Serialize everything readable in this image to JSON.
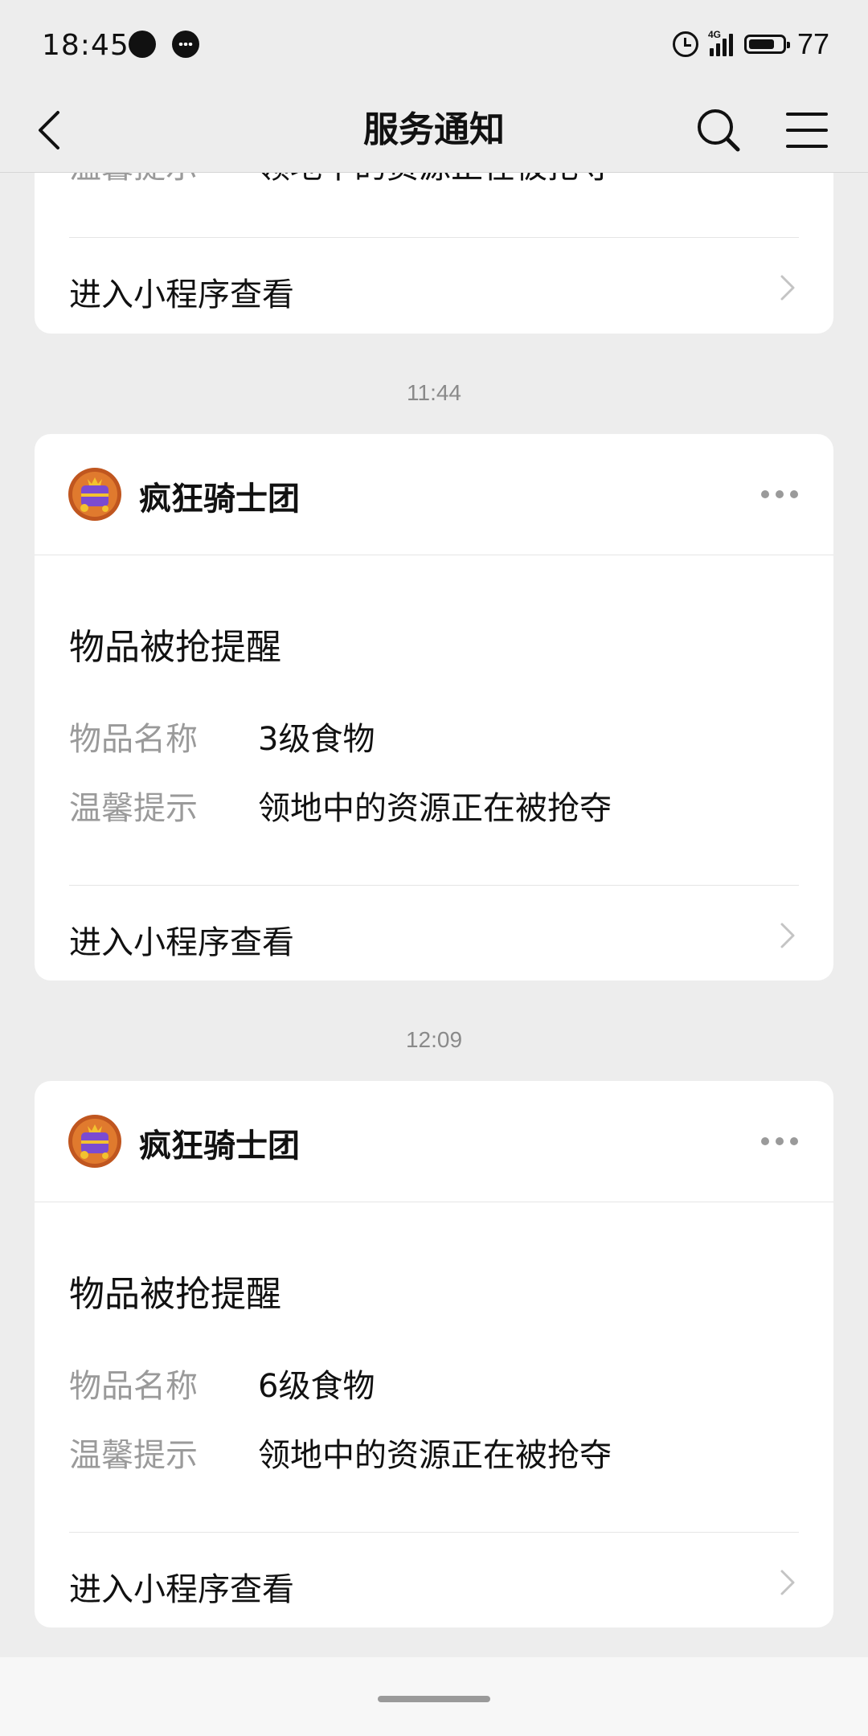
{
  "status_bar": {
    "time": "18:45",
    "network": "4G",
    "battery": "77"
  },
  "nav": {
    "title": "服务通知"
  },
  "top_card": {
    "partial_tip_label": "温馨提示",
    "partial_tip_value": "领地中的资源正在被抢夺",
    "link_label": "进入小程序查看"
  },
  "messages": [
    {
      "timestamp": "11:44",
      "sender": "疯狂骑士团",
      "title": "物品被抢提醒",
      "fields": [
        {
          "label": "物品名称",
          "value": "3级食物"
        },
        {
          "label": "温馨提示",
          "value": "领地中的资源正在被抢夺"
        }
      ],
      "link_label": "进入小程序查看"
    },
    {
      "timestamp": "12:09",
      "sender": "疯狂骑士团",
      "title": "物品被抢提醒",
      "fields": [
        {
          "label": "物品名称",
          "value": "6级食物"
        },
        {
          "label": "温馨提示",
          "value": "领地中的资源正在被抢夺"
        }
      ],
      "link_label": "进入小程序查看"
    }
  ],
  "icons": {
    "back": "back-icon",
    "search": "search-icon",
    "menu": "menu-icon",
    "more": "more-icon",
    "chevron": "chevron-right-icon"
  }
}
